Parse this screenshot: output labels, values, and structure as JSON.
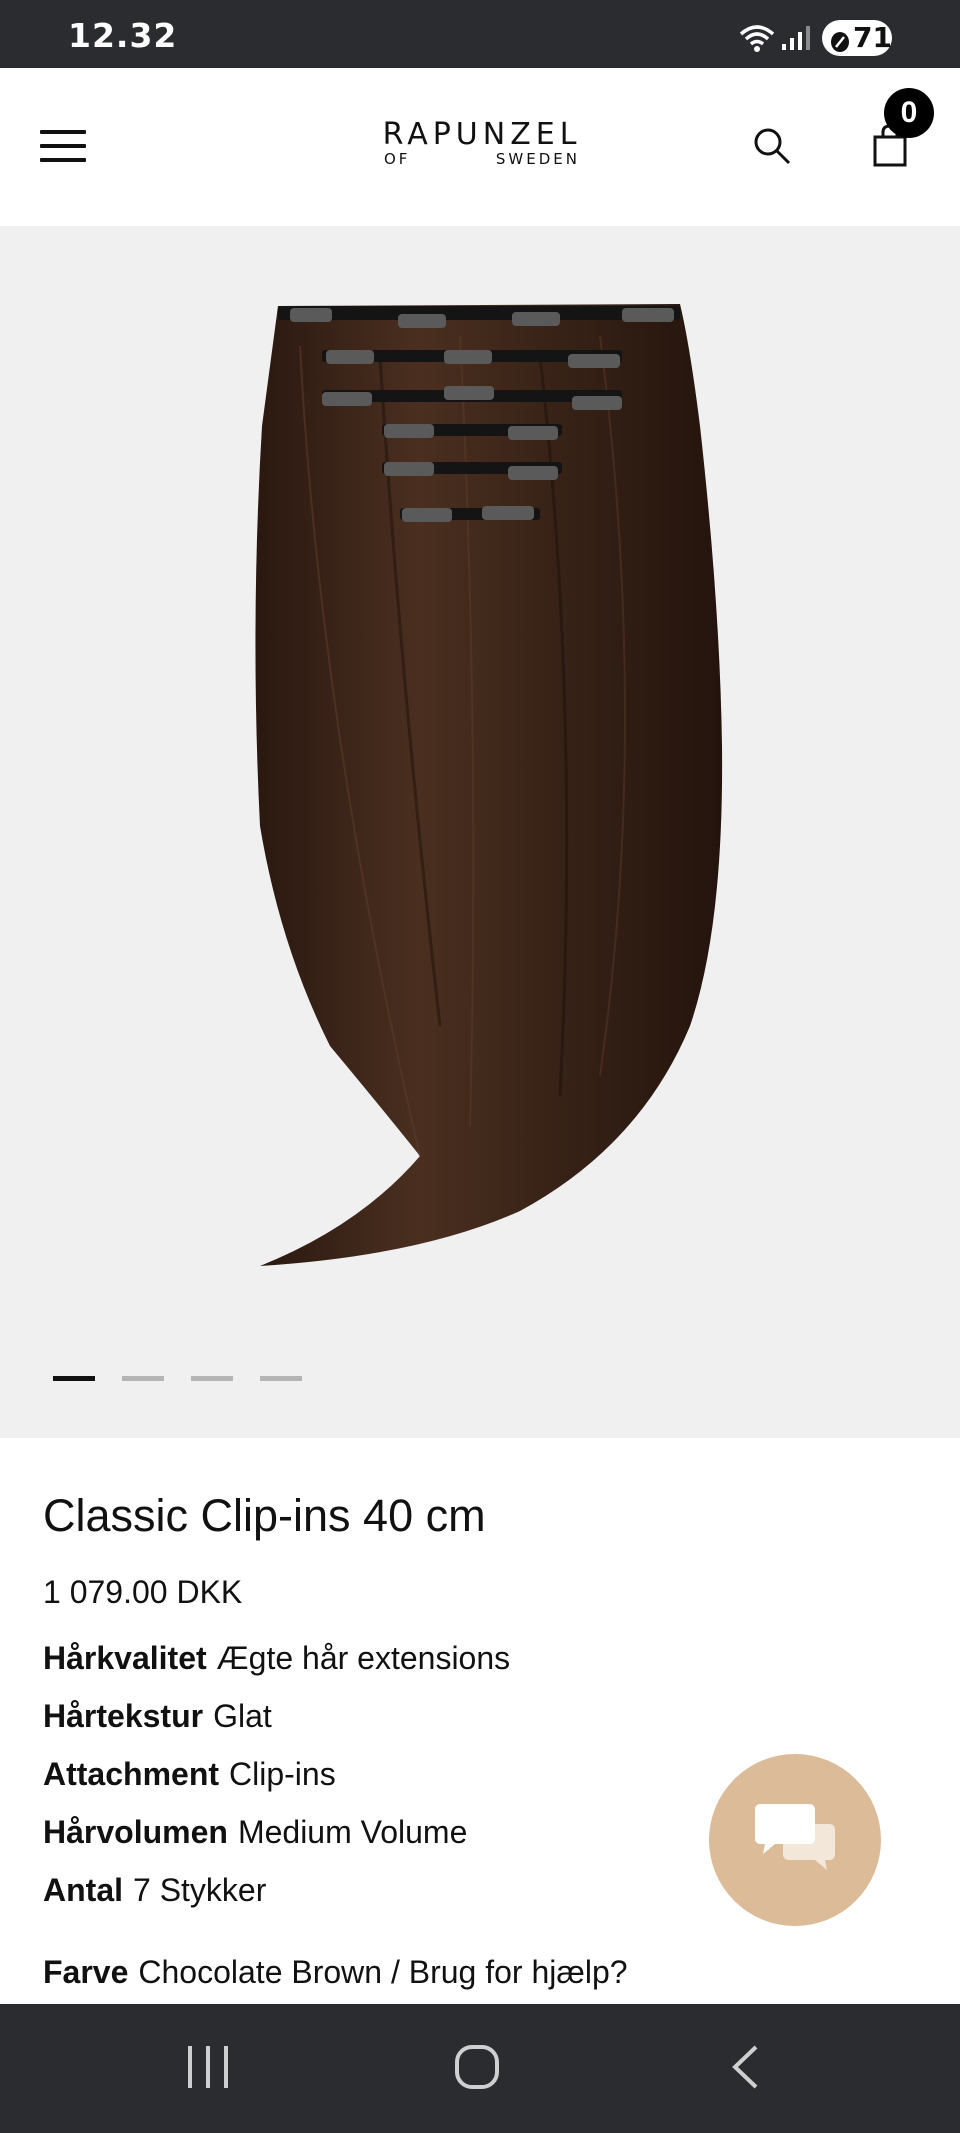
{
  "status_bar": {
    "time": "12.32",
    "battery": "71",
    "icons": [
      "wifi-icon",
      "signal-icon",
      "battery-icon"
    ]
  },
  "header": {
    "logo_line1": "RAPUNZEL",
    "logo_line2_left": "OF",
    "logo_line2_right": "SWEDEN",
    "cart_count": "0",
    "icons": [
      "menu-icon",
      "search-icon",
      "cart-icon"
    ]
  },
  "gallery": {
    "slides": 4,
    "active_slide": 1
  },
  "product": {
    "title": "Classic Clip-ins 40 cm",
    "price": "1 079.00 DKK",
    "attributes": [
      {
        "label": "Hårkvalitet",
        "value": "Ægte hår extensions"
      },
      {
        "label": "Hårtekstur",
        "value": "Glat"
      },
      {
        "label": "Attachment",
        "value": "Clip-ins"
      },
      {
        "label": "Hårvolumen",
        "value": "Medium Volume"
      },
      {
        "label": "Antal",
        "value": "7 Stykker"
      },
      {
        "label": "Farve",
        "value": "Chocolate Brown / Brug for hjælp?"
      }
    ]
  },
  "colors": {
    "status_bar": "#2b2c30",
    "gallery_bg": "#f0f0f1",
    "hair": "#3a2519",
    "chat_button": "#dcbc98"
  },
  "navigation": {
    "icons": [
      "recent-apps-icon",
      "home-icon",
      "back-icon"
    ]
  }
}
